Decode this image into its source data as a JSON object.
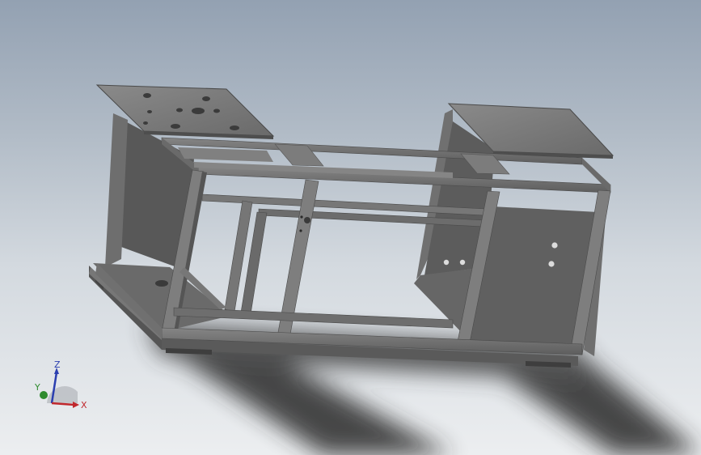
{
  "viewport": {
    "background_top": "#93a1b2",
    "background_bottom": "#eceef0"
  },
  "model": {
    "frame_color": "#6e6e6e",
    "frame_dark": "#4a4a4a",
    "frame_light": "#8c8c8c",
    "panel_color": "#5f5f5f",
    "plate_color": "#7a7a7a",
    "shadow_color": "#2a2a2a"
  },
  "triad": {
    "x_label": "X",
    "y_label": "Y",
    "z_label": "Z",
    "x_color": "#c0282d",
    "y_color": "#2e8b2e",
    "z_color": "#2b3fb0"
  }
}
